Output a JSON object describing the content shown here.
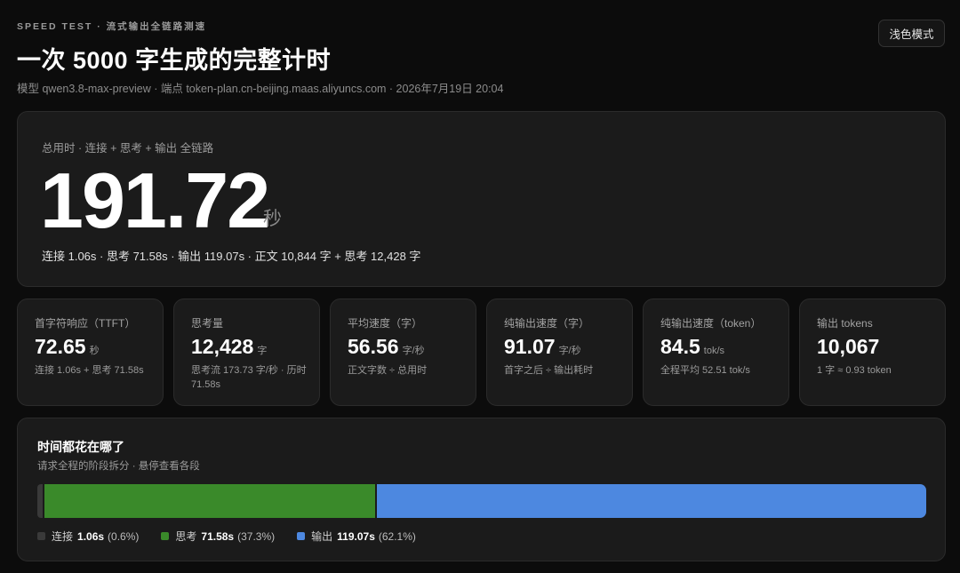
{
  "header": {
    "eyebrow": "SPEED TEST · 流式输出全链路测速",
    "title": "一次 5000 字生成的完整计时",
    "meta": "模型 qwen3.8-max-preview · 端点 token-plan.cn-beijing.maas.aliyuncs.com · 2026年7月19日 20:04",
    "theme_button": "浅色模式"
  },
  "hero": {
    "label": "总用时 · 连接 + 思考 + 输出 全链路",
    "value": "191.72",
    "unit": "秒",
    "breakdown": "连接 1.06s · 思考 71.58s · 输出 119.07s · 正文 10,844 字 + 思考 12,428 字"
  },
  "stats": [
    {
      "label": "首字符响应（TTFT）",
      "value": "72.65",
      "unit": "秒",
      "sub": "连接 1.06s + 思考 71.58s"
    },
    {
      "label": "思考量",
      "value": "12,428",
      "unit": "字",
      "sub": "思考流 173.73 字/秒 · 历时 71.58s"
    },
    {
      "label": "平均速度（字）",
      "value": "56.56",
      "unit": "字/秒",
      "sub": "正文字数 ÷ 总用时"
    },
    {
      "label": "纯输出速度（字）",
      "value": "91.07",
      "unit": "字/秒",
      "sub": "首字之后 ÷ 输出耗时"
    },
    {
      "label": "纯输出速度（token）",
      "value": "84.5",
      "unit": "tok/s",
      "sub": "全程平均 52.51 tok/s"
    },
    {
      "label": "输出 tokens",
      "value": "10,067",
      "unit": "",
      "sub": "1 字 ≈ 0.93 token"
    }
  ],
  "timeline": {
    "title": "时间都花在哪了",
    "subtitle": "请求全程的阶段拆分 · 悬停查看各段",
    "segments": [
      {
        "name": "连接",
        "value": "1.06s",
        "percent": "(0.6%)",
        "fraction": 0.006,
        "color": "#3a3a3a"
      },
      {
        "name": "思考",
        "value": "71.58s",
        "percent": "(37.3%)",
        "fraction": 0.373,
        "color": "#3a8a2a"
      },
      {
        "name": "输出",
        "value": "119.07s",
        "percent": "(62.1%)",
        "fraction": 0.621,
        "color": "#4d88e0"
      }
    ]
  }
}
